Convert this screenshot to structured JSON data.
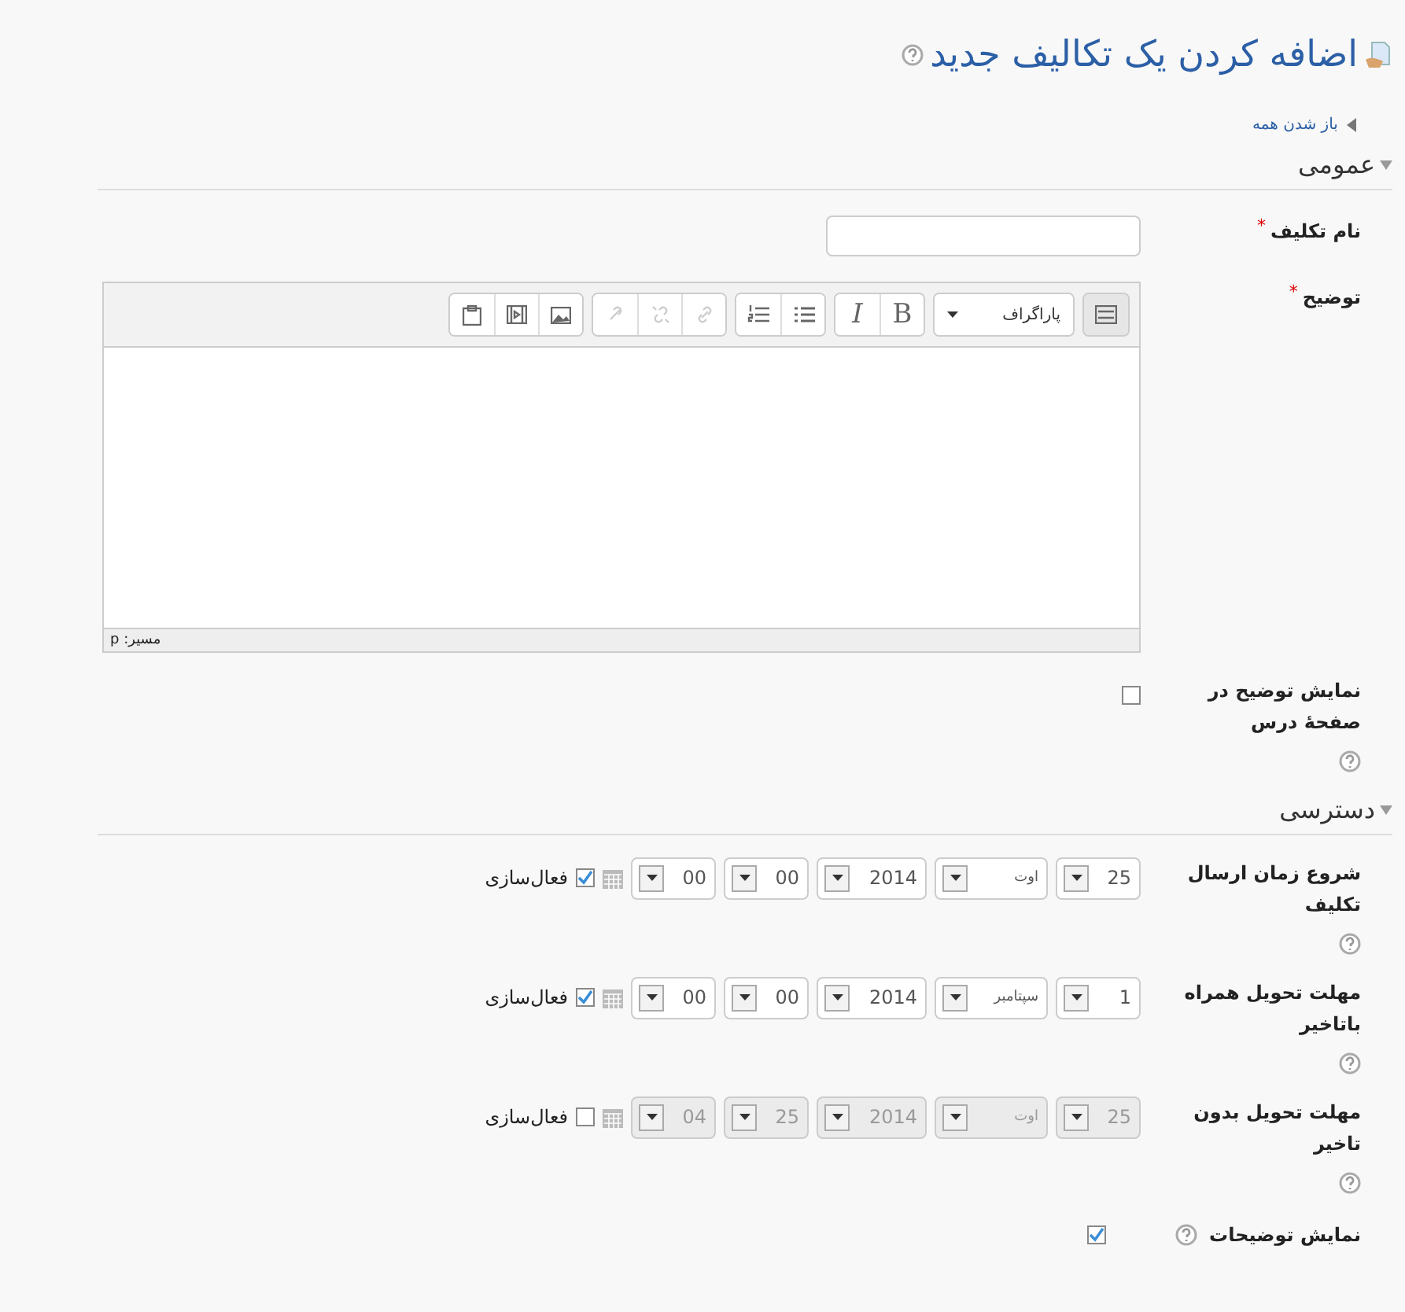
{
  "page": {
    "title": "اضافه کردن یک تکالیف جدید"
  },
  "expand_all": {
    "label": "باز شدن همه"
  },
  "sections": [
    {
      "title": "عمومی",
      "expanded": true,
      "fields": [
        {
          "kind": "text",
          "label": "نام تکلیف",
          "required_mark": "*"
        },
        {
          "kind": "editor",
          "label": "توضیح",
          "required_mark": "*",
          "toolbar": [
            [
              {
                "kind": "toggle",
                "disabled": false
              }
            ],
            [
              {
                "kind": "format",
                "label": "پاراگراف",
                "disabled": false
              }
            ],
            [
              {
                "kind": "bold",
                "label": "B",
                "disabled": false
              },
              {
                "kind": "italic",
                "label": "I",
                "disabled": false
              }
            ],
            [
              {
                "kind": "bullets",
                "disabled": false
              },
              {
                "kind": "numbers",
                "disabled": false
              }
            ],
            [
              {
                "kind": "link",
                "disabled": true
              },
              {
                "kind": "unlink",
                "disabled": true
              },
              {
                "kind": "anchor",
                "disabled": true
              }
            ],
            [
              {
                "kind": "image",
                "disabled": false
              },
              {
                "kind": "media",
                "disabled": false
              },
              {
                "kind": "paste",
                "disabled": false
              }
            ]
          ],
          "status_path": "مسیر: p"
        },
        {
          "kind": "checkbox",
          "label": "نمایش توضیح در صفحهٔ درس",
          "checked": false,
          "help": true
        }
      ]
    },
    {
      "title": "دسترسی",
      "expanded": true,
      "fields": [
        {
          "kind": "date",
          "label": "شروع زمان ارسال تکلیف",
          "help": true,
          "enabled": true,
          "enable_label": "فعال‌سازی",
          "parts": [
            "25",
            "اوت",
            "2014",
            "00",
            "00"
          ]
        },
        {
          "kind": "date",
          "label": "مهلت تحویل همراه باتاخیر",
          "help": true,
          "enabled": true,
          "enable_label": "فعال‌سازی",
          "parts": [
            "1",
            "سپتامبر",
            "2014",
            "00",
            "00"
          ]
        },
        {
          "kind": "date",
          "label": "مهلت تحویل بدون تاخیر",
          "help": true,
          "enabled": false,
          "enable_label": "فعال‌سازی",
          "parts": [
            "25",
            "اوت",
            "2014",
            "25",
            "04"
          ]
        },
        {
          "kind": "inline_checkbox",
          "label": "نمایش توضیحات",
          "checked": true,
          "help": true
        }
      ]
    }
  ]
}
